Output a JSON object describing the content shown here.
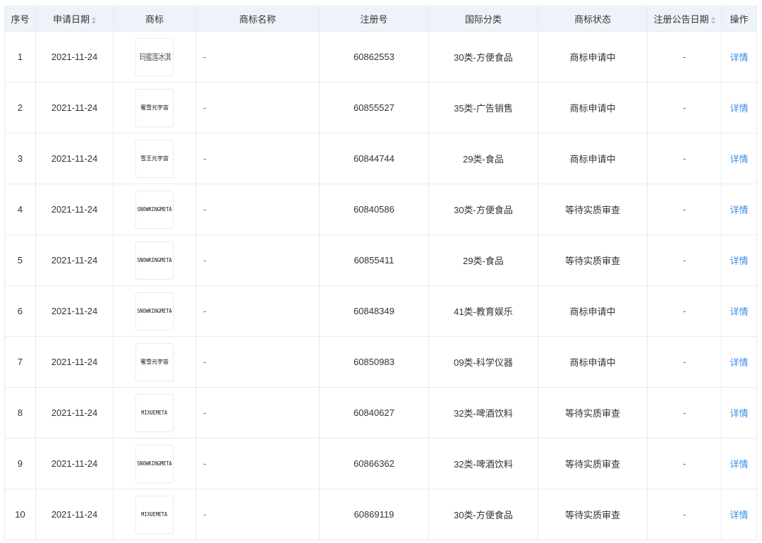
{
  "columns": {
    "seq": "序号",
    "apply_date": "申请日期",
    "logo": "商标",
    "name": "商标名称",
    "reg_no": "注册号",
    "intl_class": "国际分类",
    "status": "商标状态",
    "pub_date": "注册公告日期",
    "action": "操作"
  },
  "colors": {
    "header_bg": "#eef3f9",
    "border": "#e6ecf2",
    "link": "#3a8ee6"
  },
  "rows": [
    {
      "seq": "1",
      "apply_date": "2021-11-24",
      "logo": "玛蜜莲冰淇",
      "logo_style": "script",
      "name": "-",
      "reg_no": "60862553",
      "intl_class": "30类-方便食品",
      "status": "商标申请中",
      "pub_date": "-",
      "action": "详情"
    },
    {
      "seq": "2",
      "apply_date": "2021-11-24",
      "logo": "蜜雪元宇宙",
      "logo_style": "cn",
      "name": "-",
      "reg_no": "60855527",
      "intl_class": "35类-广告销售",
      "status": "商标申请中",
      "pub_date": "-",
      "action": "详情"
    },
    {
      "seq": "3",
      "apply_date": "2021-11-24",
      "logo": "雪王元宇宙",
      "logo_style": "cn",
      "name": "-",
      "reg_no": "60844744",
      "intl_class": "29类-食品",
      "status": "商标申请中",
      "pub_date": "-",
      "action": "详情"
    },
    {
      "seq": "4",
      "apply_date": "2021-11-24",
      "logo": "SNOWKINGMETA",
      "logo_style": "en",
      "name": "-",
      "reg_no": "60840586",
      "intl_class": "30类-方便食品",
      "status": "等待实质审查",
      "pub_date": "-",
      "action": "详情"
    },
    {
      "seq": "5",
      "apply_date": "2021-11-24",
      "logo": "SNOWKINGMETA",
      "logo_style": "en",
      "name": "-",
      "reg_no": "60855411",
      "intl_class": "29类-食品",
      "status": "等待实质审查",
      "pub_date": "-",
      "action": "详情"
    },
    {
      "seq": "6",
      "apply_date": "2021-11-24",
      "logo": "SNOWKINGMETA",
      "logo_style": "en",
      "name": "-",
      "reg_no": "60848349",
      "intl_class": "41类-教育娱乐",
      "status": "商标申请中",
      "pub_date": "-",
      "action": "详情"
    },
    {
      "seq": "7",
      "apply_date": "2021-11-24",
      "logo": "蜜雪元宇宙",
      "logo_style": "cn",
      "name": "-",
      "reg_no": "60850983",
      "intl_class": "09类-科学仪器",
      "status": "商标申请中",
      "pub_date": "-",
      "action": "详情"
    },
    {
      "seq": "8",
      "apply_date": "2021-11-24",
      "logo": "MIXUEMETA",
      "logo_style": "en",
      "name": "-",
      "reg_no": "60840627",
      "intl_class": "32类-啤酒饮料",
      "status": "等待实质审查",
      "pub_date": "-",
      "action": "详情"
    },
    {
      "seq": "9",
      "apply_date": "2021-11-24",
      "logo": "SNOWKINGMETA",
      "logo_style": "en",
      "name": "-",
      "reg_no": "60866362",
      "intl_class": "32类-啤酒饮料",
      "status": "等待实质审查",
      "pub_date": "-",
      "action": "详情"
    },
    {
      "seq": "10",
      "apply_date": "2021-11-24",
      "logo": "MIXUEMETA",
      "logo_style": "en",
      "name": "-",
      "reg_no": "60869119",
      "intl_class": "30类-方便食品",
      "status": "等待实质审查",
      "pub_date": "-",
      "action": "详情"
    }
  ]
}
